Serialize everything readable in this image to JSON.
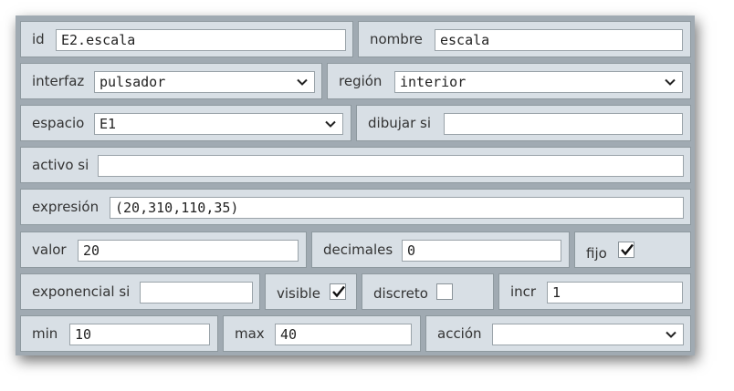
{
  "fields": {
    "id": {
      "label": "id",
      "value": "E2.escala"
    },
    "nombre": {
      "label": "nombre",
      "value": "escala"
    },
    "interfaz": {
      "label": "interfaz",
      "value": "pulsador"
    },
    "region": {
      "label": "región",
      "value": "interior"
    },
    "espacio": {
      "label": "espacio",
      "value": "E1"
    },
    "dibujar_si": {
      "label": "dibujar si",
      "value": ""
    },
    "activo_si": {
      "label": "activo si",
      "value": ""
    },
    "expresion": {
      "label": "expresión",
      "value": "(20,310,110,35)"
    },
    "valor": {
      "label": "valor",
      "value": "20"
    },
    "decimales": {
      "label": "decimales",
      "value": "0"
    },
    "fijo": {
      "label": "fijo",
      "checked": true
    },
    "exponencial_si": {
      "label": "exponencial si",
      "value": ""
    },
    "visible": {
      "label": "visible",
      "checked": true
    },
    "discreto": {
      "label": "discreto",
      "checked": false
    },
    "incr": {
      "label": "incr",
      "value": "1"
    },
    "min": {
      "label": "min",
      "value": "10"
    },
    "max": {
      "label": "max",
      "value": "40"
    },
    "accion": {
      "label": "acción",
      "value": ""
    }
  },
  "icons": {
    "dropdown": "chevron-down-icon",
    "check": "checkmark-icon"
  },
  "colors": {
    "panel": "#a0aab2",
    "cell": "#d8dfe5",
    "input": "#ffffff"
  }
}
